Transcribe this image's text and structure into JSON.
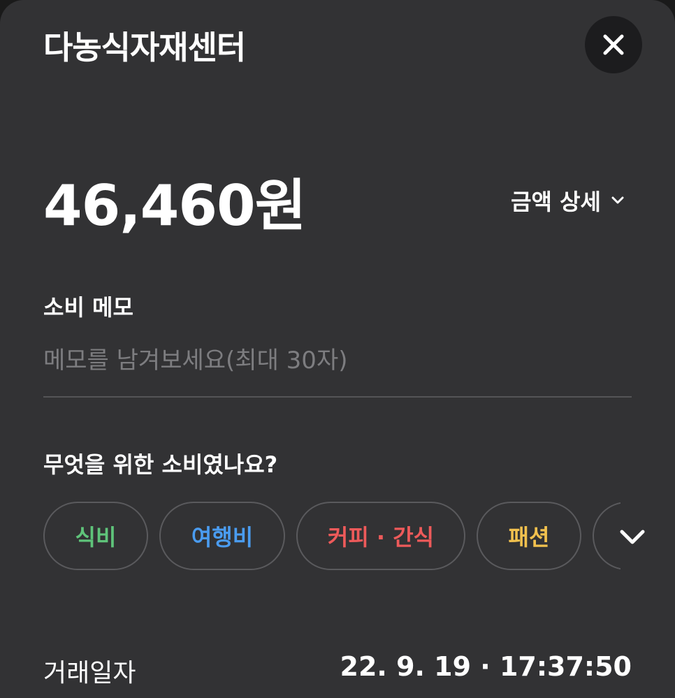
{
  "merchant": {
    "name": "다농식자재센터"
  },
  "amount": {
    "value": "46,460원",
    "detail_label": "금액 상세"
  },
  "memo": {
    "label": "소비 메모",
    "placeholder": "메모를 남겨보세요(최대 30자)",
    "value": ""
  },
  "category": {
    "question": "무엇을 위한 소비였나요?",
    "chips": [
      {
        "label": "식비",
        "color": "#5fc47a"
      },
      {
        "label": "여행비",
        "color": "#4a9cf0"
      },
      {
        "label": "커피 · 간식",
        "color": "#ee5a5a"
      },
      {
        "label": "패션",
        "color": "#f2c14e"
      }
    ]
  },
  "transaction": {
    "date_label": "거래일자",
    "date_value": "22. 9. 19 · 17:37:50"
  },
  "colors": {
    "background": "#323234",
    "close_button_bg": "#1c1c1e",
    "divider": "#545457",
    "chip_border": "#5a5a5d",
    "placeholder": "#7d7d80"
  },
  "icons": {
    "close": "close-icon",
    "detail_expand": "chevron-down-icon",
    "more_categories": "chevron-down-icon"
  }
}
